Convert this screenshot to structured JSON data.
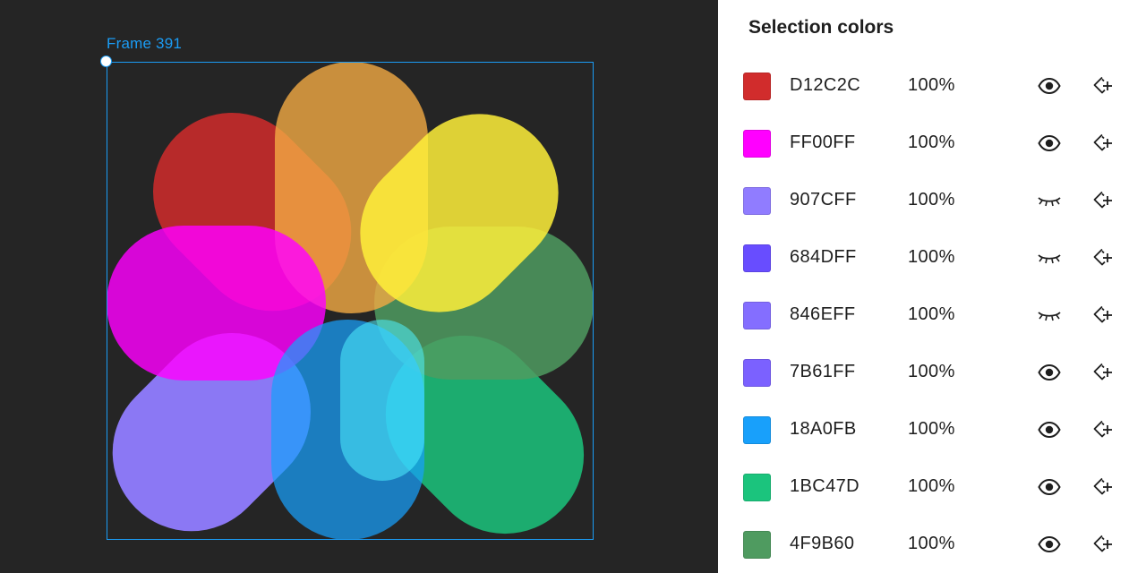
{
  "canvas": {
    "frame_label": "Frame 391",
    "accent_color": "#1b9cf5",
    "background_color": "#252525"
  },
  "panel": {
    "title": "Selection colors",
    "colors": [
      {
        "hex": "D12C2C",
        "swatch": "#D12C2C",
        "opacity": "100%",
        "visibility_icon": "eye-icon"
      },
      {
        "hex": "FF00FF",
        "swatch": "#FF00FF",
        "opacity": "100%",
        "visibility_icon": "eye-icon"
      },
      {
        "hex": "907CFF",
        "swatch": "#907CFF",
        "opacity": "100%",
        "visibility_icon": "eye-closed-icon"
      },
      {
        "hex": "684DFF",
        "swatch": "#684DFF",
        "opacity": "100%",
        "visibility_icon": "eye-closed-icon"
      },
      {
        "hex": "846EFF",
        "swatch": "#846EFF",
        "opacity": "100%",
        "visibility_icon": "eye-closed-icon"
      },
      {
        "hex": "7B61FF",
        "swatch": "#7B61FF",
        "opacity": "100%",
        "visibility_icon": "eye-icon"
      },
      {
        "hex": "18A0FB",
        "swatch": "#18A0FB",
        "opacity": "100%",
        "visibility_icon": "eye-icon"
      },
      {
        "hex": "1BC47D",
        "swatch": "#1BC47D",
        "opacity": "100%",
        "visibility_icon": "eye-icon"
      },
      {
        "hex": "4F9B60",
        "swatch": "#4F9B60",
        "opacity": "100%",
        "visibility_icon": "eye-icon"
      }
    ]
  }
}
